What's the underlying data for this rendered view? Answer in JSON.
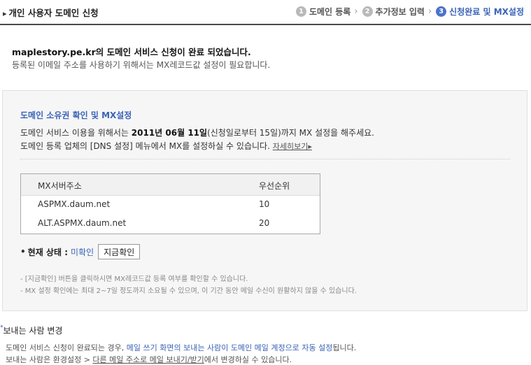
{
  "header": {
    "title": "개인 사용자 도메인 신청",
    "steps": [
      {
        "num": "1",
        "label": "도메인 등록"
      },
      {
        "num": "2",
        "label": "추가정보 입력"
      },
      {
        "num": "3",
        "label": "신청완료 및 MX설정"
      }
    ],
    "active_step": 3
  },
  "intro": {
    "domain": "maplestory.pe.kr",
    "line1_suffix": "의 도메인 서비스 신청이 완료 되었습니다.",
    "line2": "등록된 이메일 주소를 사용하기 위해서는 MX레코드값 설정이 필요합니다."
  },
  "mx_section": {
    "title": "도메인 소유권 확인 및 MX설정",
    "desc1_pre": "도메인 서비스 이용을 위해서는 ",
    "desc1_date": "2011년 06월 11일",
    "desc1_post": "(신청일로부터 15일)까지 MX 설정을 해주세요.",
    "desc2": "도메인 등록 업체의 [DNS 설정] 메뉴에서 MX를 설정하실 수 있습니다.",
    "more_link": "자세히보기▸",
    "table": {
      "headers": [
        "MX서버주소",
        "우선순위"
      ],
      "rows": [
        {
          "server": "ASPMX.daum.net",
          "priority": "10"
        },
        {
          "server": "ALT.ASPMX.daum.net",
          "priority": "20"
        }
      ]
    },
    "status": {
      "bullet": "•",
      "label": "현재 상태 :",
      "value": "미확인",
      "button": "지금확인"
    },
    "notes": [
      "- [지금확인] 버튼을 클릭하시면 MX레코드값 등록 여부를 확인할 수 있습니다.",
      "- MX 설정 확인에는 최대 2~7일 정도까지 소요될 수 있으며, 이 기간 동안 메일 수신이 원활하지 않을 수 있습니다."
    ]
  },
  "sender": {
    "star": "*",
    "title": "보내는 사람 변경",
    "line1_pre": "도메인 서비스 신청이 완료되는 경우, ",
    "line1_highlight": "메일 쓰기 화면의 보내는 사람이 도메인 메일 계정으로 자동 설정",
    "line1_post": "됩니다.",
    "line2_pre": "보내는 사람은 환경설정 > ",
    "line2_link": "다른 메일 주소로 메일 보내기/받기",
    "line2_post": "에서 변경하실 수 있습니다."
  },
  "colors": {
    "accent": "#3a63b6",
    "step_inactive": "#b9b9b9",
    "step_active": "#4b73c9",
    "box_bg": "#f6f6f6"
  }
}
